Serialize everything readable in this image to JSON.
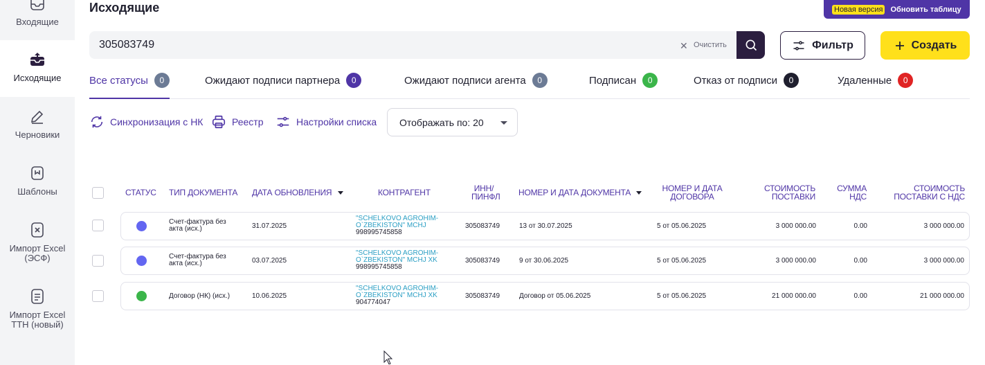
{
  "sidebar": {
    "items": [
      {
        "label": "Входящие",
        "icon": "inbox-icon"
      },
      {
        "label": "Исходящие",
        "icon": "outbox-icon"
      },
      {
        "label": "Черновики",
        "icon": "pencil-icon"
      },
      {
        "label": "Шаблоны",
        "icon": "bookmark-icon"
      },
      {
        "label": "Импорт Excel (ЭСФ)",
        "icon": "excel-file-icon"
      },
      {
        "label": "Импорт Excel ТТН (новый)",
        "icon": "excel-file-icon"
      }
    ]
  },
  "header": {
    "title": "Исходящие",
    "new_version_badge": "Новая версия",
    "refresh_table": "Обновить таблицу"
  },
  "search": {
    "value": "305083749",
    "clear_label": "Очистить"
  },
  "actions": {
    "filter_label": "Фильтр",
    "create_label": "Создать"
  },
  "tabs": [
    {
      "label": "Все статусы",
      "count": "0",
      "color": "#6c7b95"
    },
    {
      "label": "Ожидают подписи партнера",
      "count": "0",
      "color": "#4f35a6"
    },
    {
      "label": "Ожидают подписи агента",
      "count": "0",
      "color": "#6c7b95"
    },
    {
      "label": "Подписан",
      "count": "0",
      "color": "#3bb54a"
    },
    {
      "label": "Отказ от подписи",
      "count": "0",
      "color": "#1f1f2e"
    },
    {
      "label": "Удаленные",
      "count": "0",
      "color": "#e02424"
    }
  ],
  "toolbar": {
    "sync_label": "Синхронизация с НК",
    "registry_label": "Реестр",
    "list_settings_label": "Настройки списка",
    "per_page_label": "Отображать по: 20"
  },
  "table": {
    "headers": {
      "status": "СТАТУС",
      "doc_type": "ТИП ДОКУМЕНТА",
      "updated": "ДАТА ОБНОВЛЕНИЯ",
      "partner": "КОНТРАГЕНТ",
      "inn_1": "ИНН/",
      "inn_2": "ПИНФЛ",
      "doc_number": "НОМЕР И ДАТА ДОКУМЕНТА",
      "contract_1": "НОМЕР И ДАТА",
      "contract_2": "ДОГОВОРА",
      "supply_cost_1": "СТОИМОСТЬ",
      "supply_cost_2": "ПОСТАВКИ",
      "vat_1": "СУММА",
      "vat_2": "НДС",
      "total_1": "СТОИМОСТЬ",
      "total_2": "ПОСТАВКИ С НДС"
    },
    "rows": [
      {
        "status_color": "#6366f1",
        "doc_type_1": "Счет-фактура без",
        "doc_type_2": "акта (исх.)",
        "updated": "31.07.2025",
        "partner_1": "\"SCHELKOVO AGROHIM-",
        "partner_2": "O`ZBEKISTON\" MCHJ",
        "partner_inn": "998995745858",
        "inn": "305083749",
        "doc_number": "13 от 30.07.2025",
        "contract": "5 от 05.06.2025",
        "supply_cost": "3 000 000.00",
        "vat": "0.00",
        "total": "3 000 000.00"
      },
      {
        "status_color": "#6366f1",
        "doc_type_1": "Счет-фактура без",
        "doc_type_2": "акта (исх.)",
        "updated": "03.07.2025",
        "partner_1": "\"SCHELKOVO AGROHIM-",
        "partner_2": "O`ZBEKISTON\" MCHJ XK",
        "partner_inn": "998995745858",
        "inn": "305083749",
        "doc_number": "9 от 30.06.2025",
        "contract": "5 от 05.06.2025",
        "supply_cost": "3 000 000.00",
        "vat": "0.00",
        "total": "3 000 000.00"
      },
      {
        "status_color": "#3bb54a",
        "doc_type_1": "Договор (НК) (исх.)",
        "doc_type_2": "",
        "updated": "10.06.2025",
        "partner_1": "\"SCHELKOVO AGROHIM-",
        "partner_2": "O`ZBEKISTON\" MCHJ XK",
        "partner_inn": "904774047",
        "inn": "305083749",
        "doc_number": "Договор от 05.06.2025",
        "contract": "5 от 05.06.2025",
        "supply_cost": "21 000 000.00",
        "vat": "0.00",
        "total": "21 000 000.00"
      }
    ]
  },
  "colors": {
    "accent": "#4f35a6",
    "yellow": "#ffe01b",
    "dark": "#2b1e3f",
    "link": "#2b9fc4"
  }
}
